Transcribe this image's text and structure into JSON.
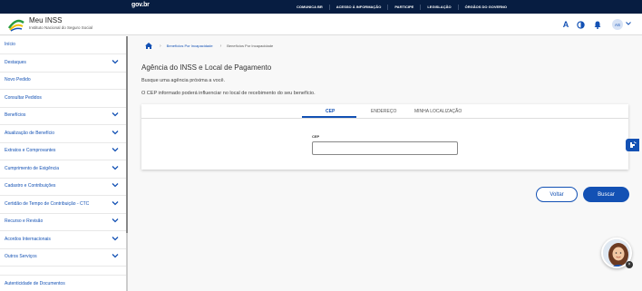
{
  "govbar": {
    "logo": "gov.br",
    "links": [
      "COMUNICA BR",
      "ACESSO À INFORMAÇÃO",
      "PARTICIPE",
      "LEGISLAÇÃO",
      "ÓRGÃOS DO GOVERNO"
    ]
  },
  "header": {
    "title": "Meu INSS",
    "subtitle": "Instituto Nacional do Seguro Social",
    "font_button": "A",
    "avatar_initials": "AS"
  },
  "sidebar": {
    "items": [
      {
        "label": "Início",
        "has_chevron": false
      },
      {
        "label": "Destaques",
        "has_chevron": true
      },
      {
        "label": "Novo Pedido",
        "has_chevron": false
      },
      {
        "label": "Consultar Pedidos",
        "has_chevron": false
      },
      {
        "label": "Benefícios",
        "has_chevron": true
      },
      {
        "label": "Atualização de Benefício",
        "has_chevron": true
      },
      {
        "label": "Extratos e Comprovantes",
        "has_chevron": true
      },
      {
        "label": "Cumprimento de Exigência",
        "has_chevron": true
      },
      {
        "label": "Cadastro e Contribuições",
        "has_chevron": true
      },
      {
        "label": "Certidão de Tempo de Contribuição - CTC",
        "has_chevron": true
      },
      {
        "label": "Recurso e Revisão",
        "has_chevron": true
      },
      {
        "label": "Acordos Internacionais",
        "has_chevron": true
      },
      {
        "label": "Outros Serviços",
        "has_chevron": true
      },
      {
        "label": "Autenticidade de Documentos",
        "has_chevron": false
      }
    ]
  },
  "breadcrumb": {
    "items": [
      "Benefícios Por Incapacidade",
      "Benefícios Por Incapacidade"
    ]
  },
  "main": {
    "title": "Agência do INSS e Local de Pagamento",
    "subtitle": "Busque uma agência próxima a você.",
    "info": "O CEP informado poderá influenciar no local de recebimento do seu benefício.",
    "tabs": [
      {
        "label": "CEP",
        "active": true
      },
      {
        "label": "ENDEREÇO",
        "active": false
      },
      {
        "label": "MINHA LOCALIZAÇÃO",
        "active": false
      }
    ],
    "cep_label": "CEP",
    "cep_value": "",
    "back_label": "Voltar",
    "search_label": "Buscar"
  },
  "colors": {
    "govbar": "#071d41",
    "primary": "#1351b4"
  }
}
